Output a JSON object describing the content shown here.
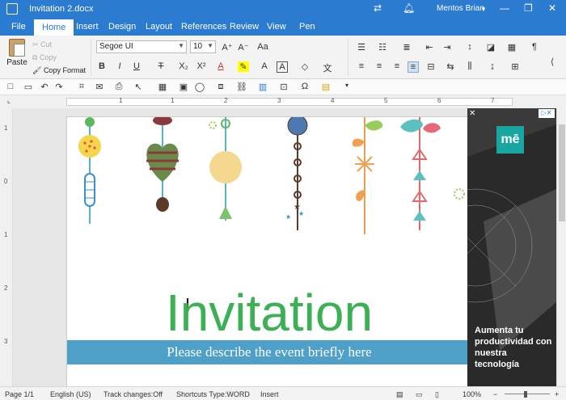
{
  "window": {
    "title": "Invitation 2.docx",
    "user": "Mentos Brian"
  },
  "tabs": [
    {
      "label": "File"
    },
    {
      "label": "Home"
    },
    {
      "label": "Insert"
    },
    {
      "label": "Design"
    },
    {
      "label": "Layout"
    },
    {
      "label": "References"
    },
    {
      "label": "Review"
    },
    {
      "label": "View"
    },
    {
      "label": "Pen"
    }
  ],
  "clipboard": {
    "paste": "Paste",
    "cut": "Cut",
    "copy": "Copy",
    "format": "Copy Format"
  },
  "font": {
    "family": "Segoe UI",
    "size": "10"
  },
  "ruler": {
    "h": [
      "1",
      "1",
      "2",
      "3",
      "4",
      "5",
      "6",
      "7"
    ],
    "v": [
      "1",
      "0",
      "1",
      "2",
      "3"
    ]
  },
  "document": {
    "heading": "Invitation",
    "subtitle": "Please describe the event briefly here"
  },
  "ad": {
    "logo": "mē",
    "text": "Aumenta tu productividad con nuestra tecnología"
  },
  "status": {
    "page": "Page 1/1",
    "lang": "English (US)",
    "track": "Track changes:Off",
    "shortcuts": "Shortcuts Type:WORD",
    "mode": "Insert",
    "zoom": "100%"
  },
  "colors": {
    "accent": "#2b7bd1",
    "green": "#3cb054",
    "band": "#4fa0c9"
  },
  "icons": [
    "bold-icon",
    "italic-icon",
    "underline-icon",
    "strikethrough-icon",
    "subscript-icon",
    "superscript-icon",
    "clear-format-icon",
    "font-color-icon",
    "highlight-icon",
    "bullets-icon",
    "numbering-icon",
    "align-left-icon",
    "align-center-icon",
    "align-right-icon",
    "justify-icon",
    "save-icon",
    "undo-icon",
    "redo-icon",
    "print-icon",
    "table-icon",
    "image-icon",
    "chart-icon",
    "symbol-icon"
  ]
}
